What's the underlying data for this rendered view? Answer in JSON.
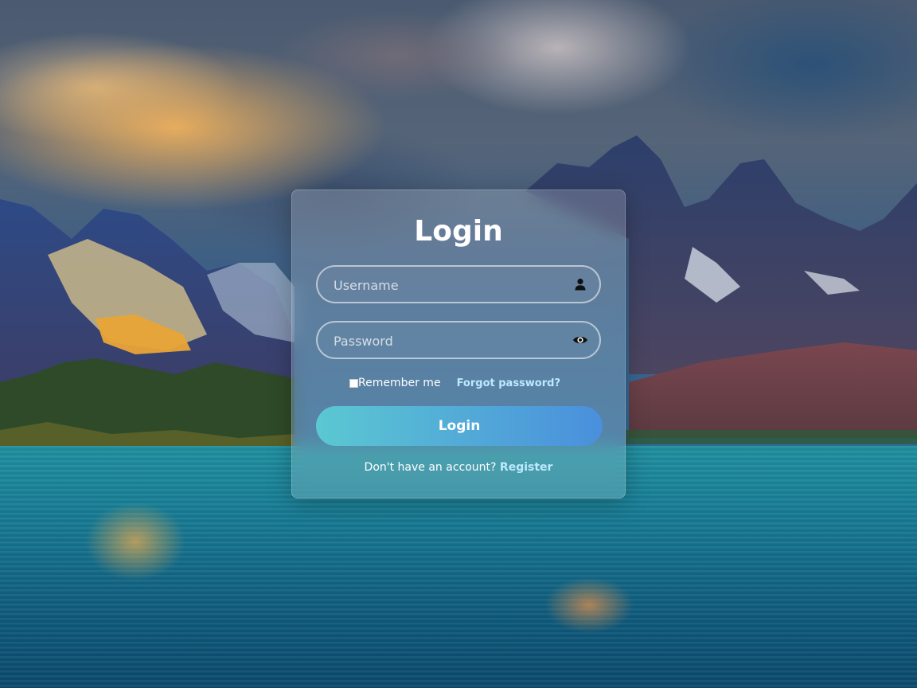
{
  "login_card": {
    "title": "Login",
    "username": {
      "placeholder": "Username",
      "icon": "user-icon"
    },
    "password": {
      "placeholder": "Password",
      "icon": "eye-icon"
    },
    "remember_label": "Remember me",
    "forgot_label": "Forgot password?",
    "submit_label": "Login",
    "register_prompt": "Don't have an account?",
    "register_label": "Register"
  },
  "colors": {
    "link": "#bfe9ff",
    "button_start": "#5bc8d2",
    "button_end": "#4a8fdc"
  }
}
